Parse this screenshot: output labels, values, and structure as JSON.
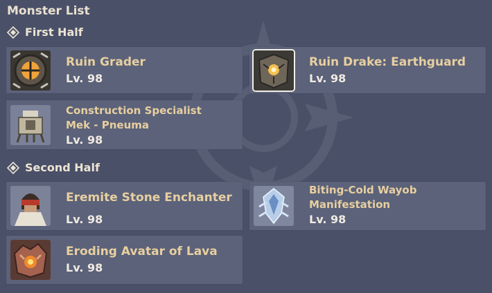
{
  "title": "Monster List",
  "sections": [
    {
      "label": "First Half",
      "monsters": [
        {
          "name": "Ruin Grader",
          "level": "Lv. 98",
          "icon": "ruin-grader-icon"
        },
        {
          "name": "Ruin Drake: Earthguard",
          "level": "Lv. 98",
          "icon": "ruin-drake-icon",
          "selected": true
        },
        {
          "name_line1": "Construction Specialist",
          "name_line2": "Mek - Pneuma",
          "level": "Lv. 98",
          "icon": "mek-icon"
        }
      ]
    },
    {
      "label": "Second Half",
      "monsters": [
        {
          "name": "Eremite Stone Enchanter",
          "level": "Lv. 98",
          "icon": "eremite-icon"
        },
        {
          "name_line1": "Biting-Cold Wayob",
          "name_line2": "Manifestation",
          "level": "Lv. 98",
          "icon": "wayob-icon"
        },
        {
          "name": "Eroding Avatar of Lava",
          "level": "Lv. 98",
          "icon": "lava-avatar-icon"
        }
      ]
    }
  ],
  "colors": {
    "background": "#4a5068",
    "card": "#5b627a",
    "name": "#e8cf9f",
    "level": "#f1ebe1"
  }
}
